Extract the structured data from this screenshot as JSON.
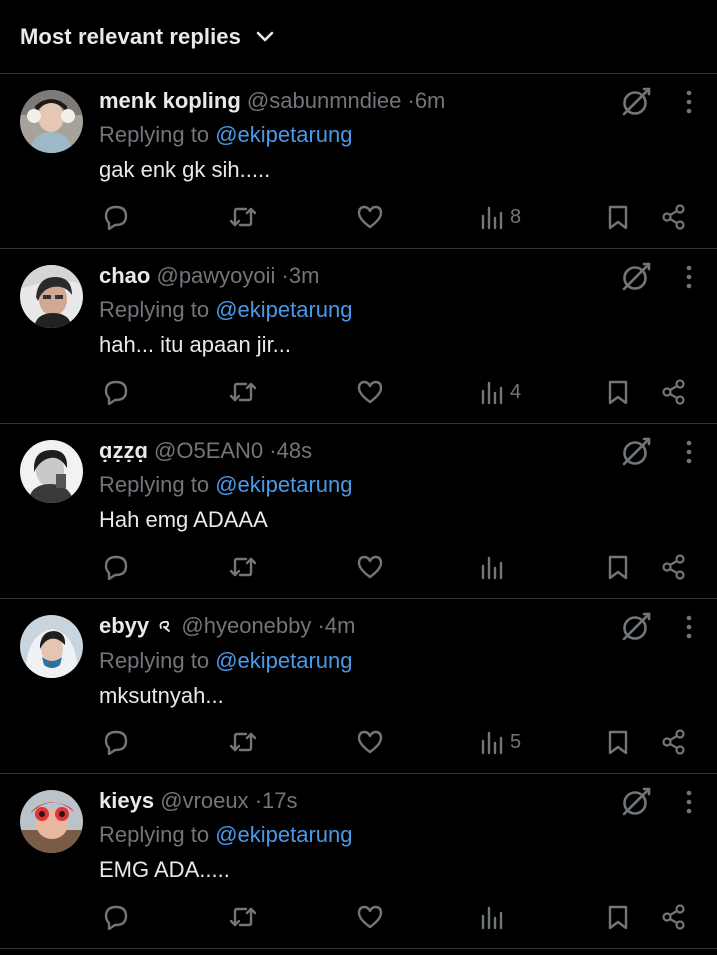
{
  "sort": {
    "label": "Most relevant replies"
  },
  "replies": [
    {
      "name": "menk kopling",
      "handle": "@sabunmndiee",
      "time": "6m",
      "replying_prefix": "Replying to",
      "replying_to": "@ekipetarung",
      "text": "gak enk gk sih.....",
      "views": "8"
    },
    {
      "name": "chao",
      "handle": "@pawyoyoii",
      "time": "3m",
      "replying_prefix": "Replying to",
      "replying_to": "@ekipetarung",
      "text": "hah... itu apaan jir...",
      "views": "4"
    },
    {
      "name": "ɑ̣ẓẓɑ̣",
      "handle": "@O5EAN0",
      "time": "48s",
      "replying_prefix": "Replying to",
      "replying_to": "@ekipetarung",
      "text": "Hah emg ADAAA",
      "views": ""
    },
    {
      "name": "ebyy",
      "handle": "@hyeonebby",
      "time": "4m",
      "replying_prefix": "Replying to",
      "replying_to": "@ekipetarung",
      "text": "mksutnyah...",
      "views": "5"
    },
    {
      "name": "kieys",
      "handle": "@vroeux",
      "time": "17s",
      "replying_prefix": "Replying to",
      "replying_to": "@ekipetarung",
      "text": "EMG ADA.....",
      "views": ""
    }
  ],
  "separator": "·",
  "colors": {
    "background": "#000000",
    "primary_text": "#e7e9ea",
    "secondary_text": "#71767b",
    "mention": "#4a99e9",
    "divider": "#2f3336"
  },
  "icons": {
    "sort": "chevron-down-icon",
    "grok": "grok-icon",
    "more": "more-vertical-icon",
    "reply": "reply-icon",
    "repost": "repost-icon",
    "like": "heart-icon",
    "views": "views-icon",
    "bookmark": "bookmark-icon",
    "share": "share-icon"
  }
}
